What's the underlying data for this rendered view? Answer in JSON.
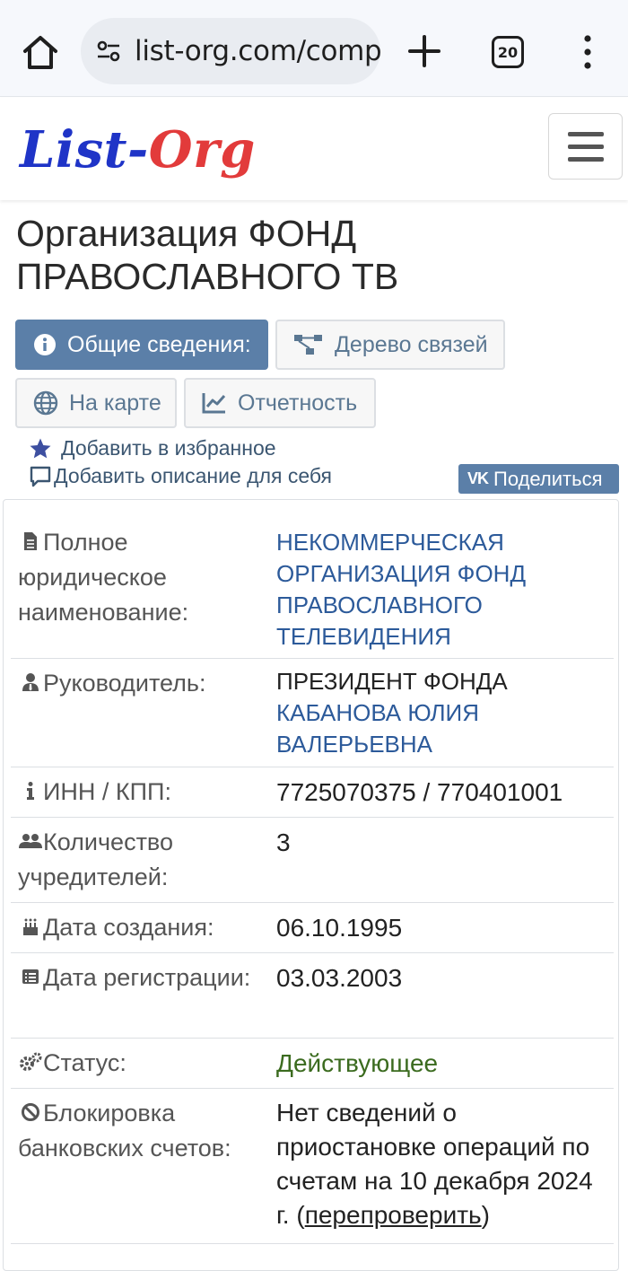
{
  "browser": {
    "url": "list-org.com/compa",
    "tab_count": "20",
    "icons": [
      "home-icon",
      "site-settings-icon",
      "new-tab-icon",
      "tab-switcher-icon",
      "menu-kebab-icon"
    ]
  },
  "site": {
    "logo_part1": "List-",
    "logo_part2": "Org",
    "logo_colors": {
      "blue": "#1f34c7",
      "red": "#e23b3b"
    }
  },
  "page": {
    "title": "Организация ФОНД ПРАВОСЛАВНОГО ТВ"
  },
  "nav": {
    "general": "Общие сведения:",
    "tree": "Дерево связей",
    "map": "На карте",
    "report": "Отчетность"
  },
  "actions": {
    "favorite": "Добавить в избранное",
    "description": "Добавить описание для себя",
    "share": "Поделиться",
    "share_brand": "VK"
  },
  "details": {
    "full_name_label": "Полное юридическое наименование:",
    "full_name_value": "НЕКОММЕРЧЕСКАЯ ОРГАНИЗАЦИЯ ФОНД ПРАВОСЛАВНОГО ТЕЛЕВИДЕНИЯ",
    "head_label": "Руководитель:",
    "head_position": "ПРЕЗИДЕНТ ФОНДА",
    "head_name": "КАБАНОВА ЮЛИЯ ВАЛЕРЬЕВНА",
    "inn_label": "ИНН / КПП:",
    "inn_value": "7725070375 / 770401001",
    "founders_label": "Количество учредителей:",
    "founders_value": "3",
    "created_label": "Дата создания:",
    "created_value": "06.10.1995",
    "registered_label": "Дата регистрации:",
    "registered_value": "03.03.2003",
    "status_label": "Статус:",
    "status_value": "Действующее",
    "block_label": "Блокировка банковских счетов:",
    "block_value": "Нет сведений о приостановке операций по счетам на 10 декабря 2024 г. (",
    "block_link": "перепроверить",
    "block_close": ")"
  },
  "colors": {
    "accent": "#5b7fa8",
    "link": "#2c5a9a",
    "status_green": "#3b6b1f"
  }
}
